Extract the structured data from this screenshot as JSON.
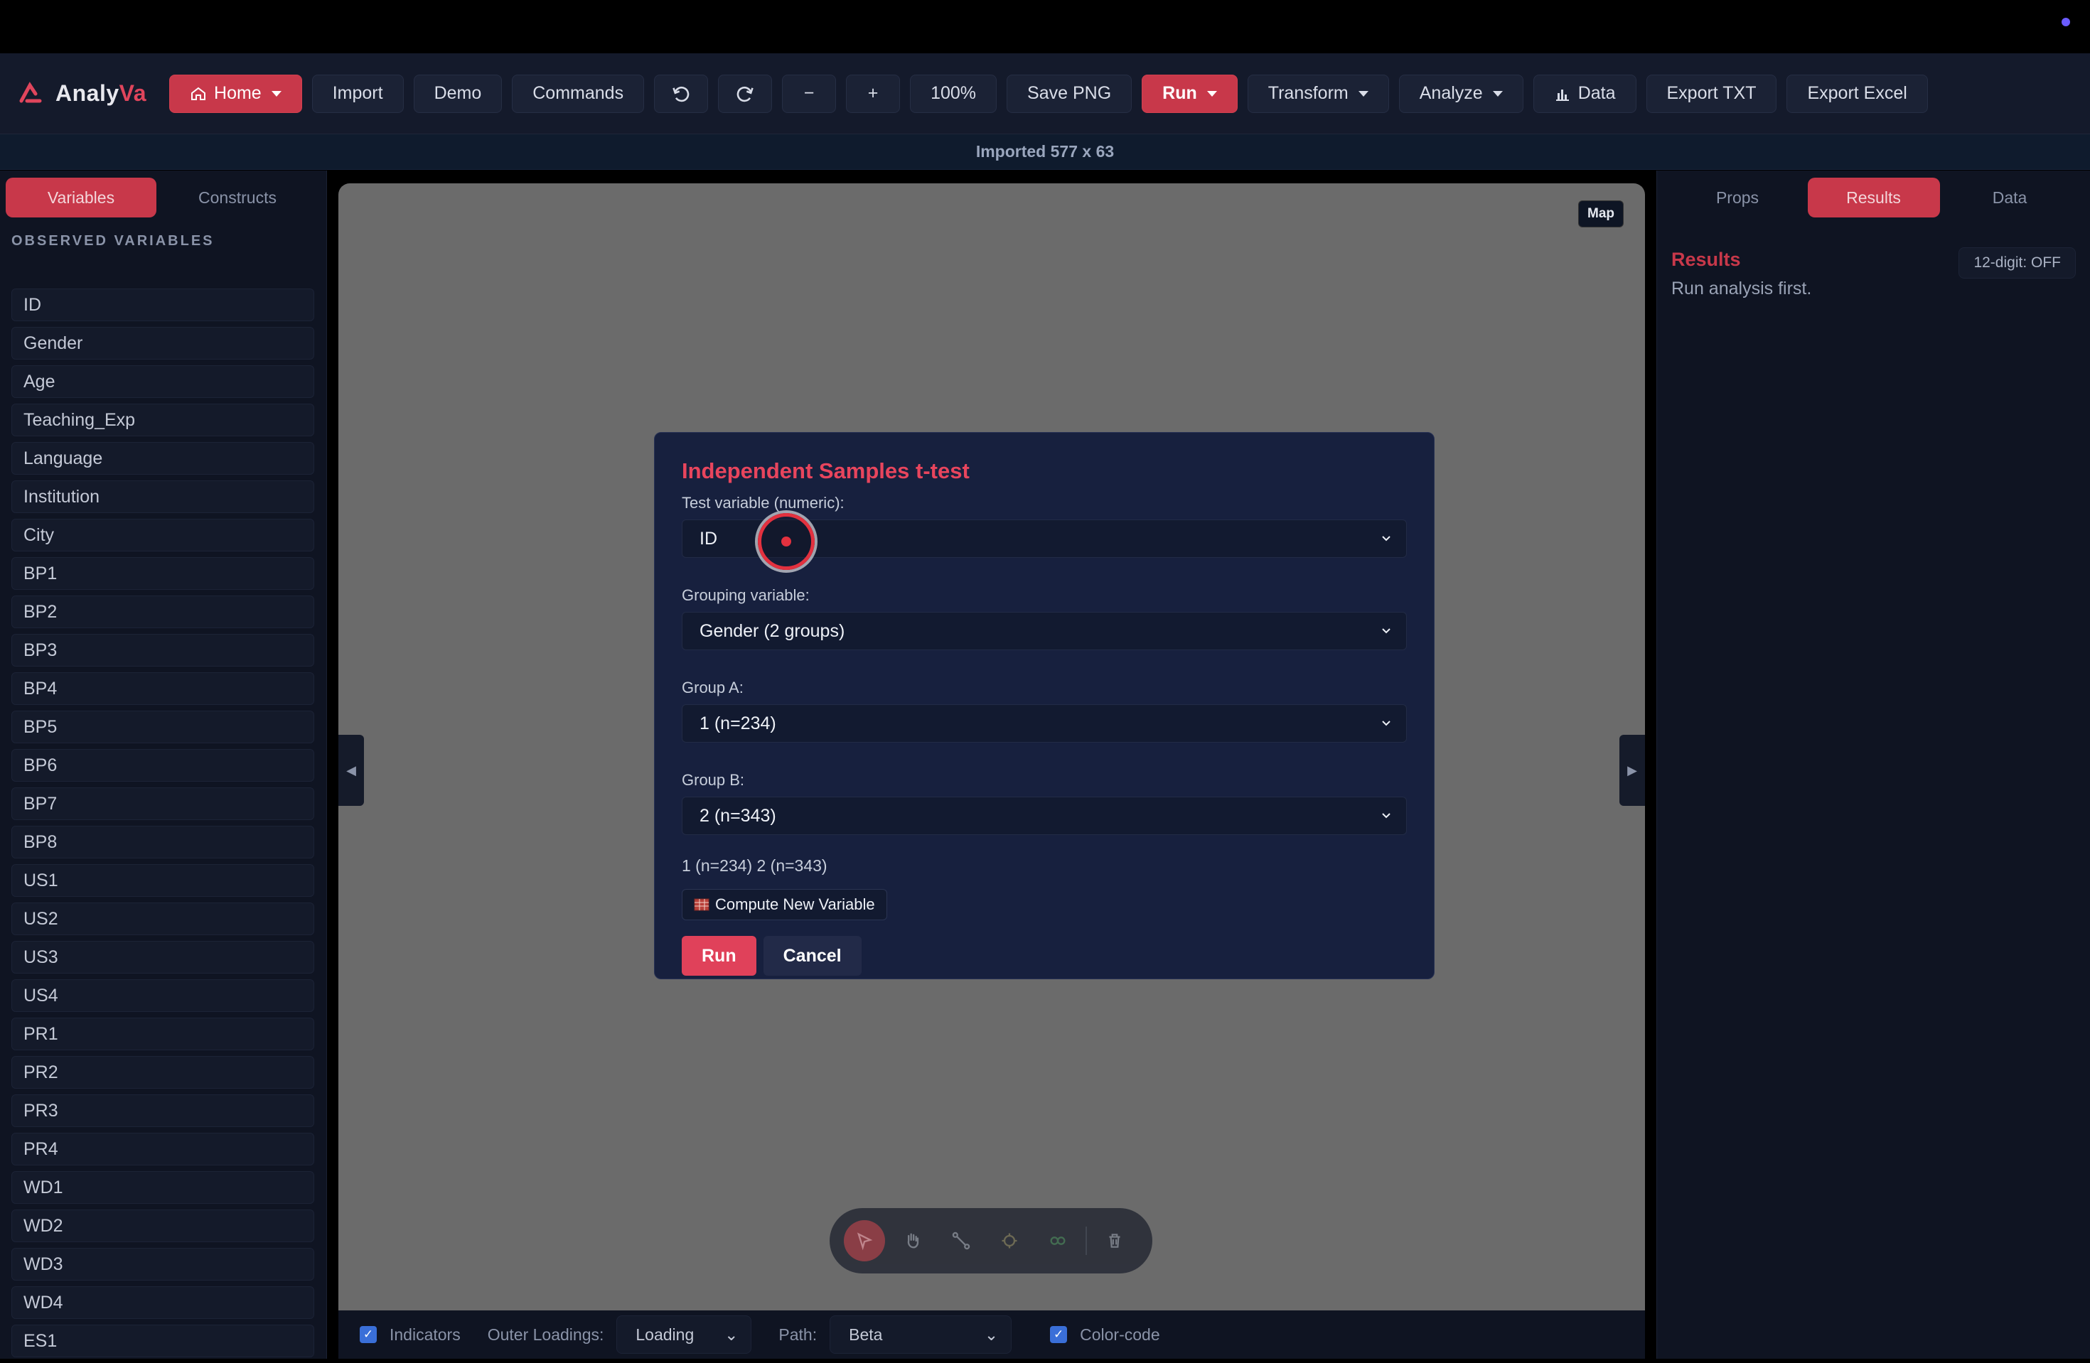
{
  "app": {
    "name_prefix": "Analy",
    "name_suffix": "Va"
  },
  "toolbar": {
    "home": "Home",
    "import": "Import",
    "demo": "Demo",
    "commands": "Commands",
    "zoom_out": "−",
    "zoom_in": "+",
    "zoom_level": "100%",
    "save_png": "Save PNG",
    "run": "Run",
    "transform": "Transform",
    "analyze": "Analyze",
    "data": "Data",
    "export_txt": "Export TXT",
    "export_excel": "Export Excel"
  },
  "status": {
    "text": "Imported 577 x 63"
  },
  "left_panel": {
    "tabs": [
      "Variables",
      "Constructs"
    ],
    "section_title": "OBSERVED VARIABLES",
    "variables": [
      "ID",
      "Gender",
      "Age",
      "Teaching_Exp",
      "Language",
      "Institution",
      "City",
      "BP1",
      "BP2",
      "BP3",
      "BP4",
      "BP5",
      "BP6",
      "BP7",
      "BP8",
      "US1",
      "US2",
      "US3",
      "US4",
      "PR1",
      "PR2",
      "PR3",
      "PR4",
      "WD1",
      "WD2",
      "WD3",
      "WD4",
      "ES1"
    ]
  },
  "canvas": {
    "map_label": "Map",
    "left_handle": "◀",
    "right_handle": "▶"
  },
  "bottom_bar": {
    "indicators_label": "Indicators",
    "outer_loadings_label": "Outer Loadings:",
    "outer_loadings_value": "Loading",
    "path_label": "Path:",
    "path_value": "Beta",
    "color_code_label": "Color-code"
  },
  "right_panel": {
    "tabs": [
      "Props",
      "Results",
      "Data"
    ],
    "results_title": "Results",
    "results_hint": "Run analysis first.",
    "digit_toggle": "12-digit: OFF"
  },
  "modal": {
    "title": "Independent Samples t-test",
    "test_variable_label": "Test variable (numeric):",
    "test_variable_value": "ID",
    "grouping_label": "Grouping variable:",
    "grouping_value": "Gender (2 groups)",
    "group_a_label": "Group A:",
    "group_a_value": "1 (n=234)",
    "group_b_label": "Group B:",
    "group_b_value": "2 (n=343)",
    "summary": "1 (n=234) 2 (n=343)",
    "compute_button": "Compute New Variable",
    "run_button": "Run",
    "cancel_button": "Cancel"
  },
  "colors": {
    "accent": "#c8384a",
    "modal_title": "#e8455d",
    "canvas_bg": "#6b6b6b"
  }
}
